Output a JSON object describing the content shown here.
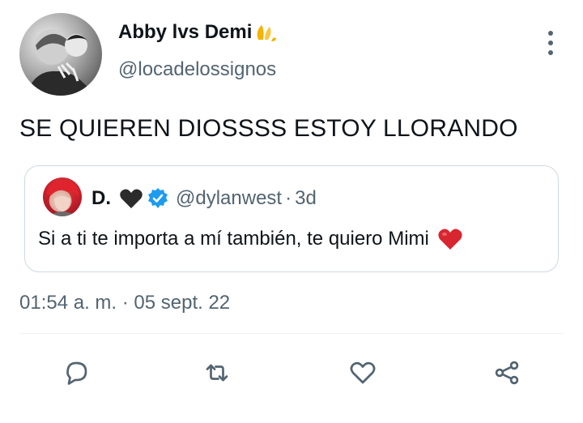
{
  "tweet": {
    "author": {
      "display_name": "Abby lvs Demi",
      "handle": "@locadelossignos",
      "name_emoji": "hands-pressed-icon"
    },
    "text": "SE QUIEREN DIOSSSS ESTOY LLORANDO",
    "quoted": {
      "display_name": "D.",
      "handle": "@dylanwest",
      "separator": "·",
      "time": "3d",
      "text": "Si a ti te importa a mí también, te quiero Mimi",
      "verified_color": "#1d9bf0",
      "heart_emoji_color": "#d7262f",
      "black_heart_color": "#2b2b2b"
    },
    "timestamp": "01:54 a. m. · 05 sept. 22"
  },
  "actions": [
    {
      "icon": "reply-icon"
    },
    {
      "icon": "retweet-icon"
    },
    {
      "icon": "like-icon"
    },
    {
      "icon": "share-icon"
    }
  ],
  "colors": {
    "text": "#0f1419",
    "secondary": "#536471",
    "border": "#cfd9de",
    "accent": "#1d9bf0"
  }
}
